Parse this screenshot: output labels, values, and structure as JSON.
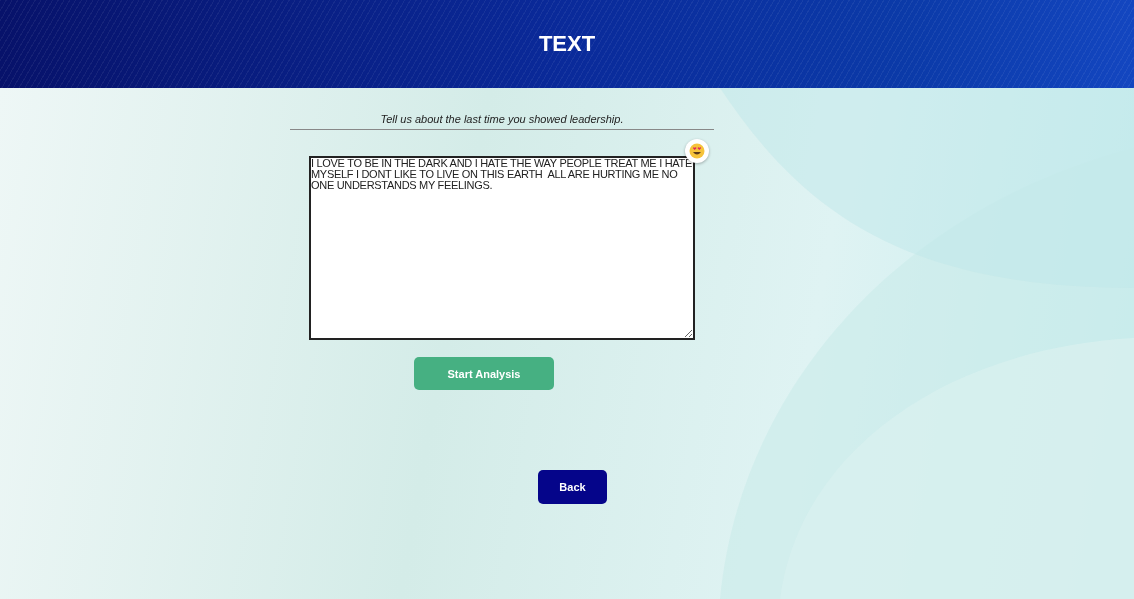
{
  "header": {
    "title": "TEXT"
  },
  "prompt": "Tell us about the last time you showed leadership.",
  "answer": {
    "value": "I LOVE TO BE IN THE DARK AND I HATE THE WAY PEOPLE TREAT ME I HATE MYSELF I DONT LIKE TO LIVE ON THIS EARTH  ALL ARE HURTING ME NO ONE UNDERSTANDS MY FEELINGS."
  },
  "buttons": [
    {
      "label": "Start Analysis",
      "kind": "primary"
    },
    {
      "label": "Back",
      "kind": "secondary"
    }
  ]
}
